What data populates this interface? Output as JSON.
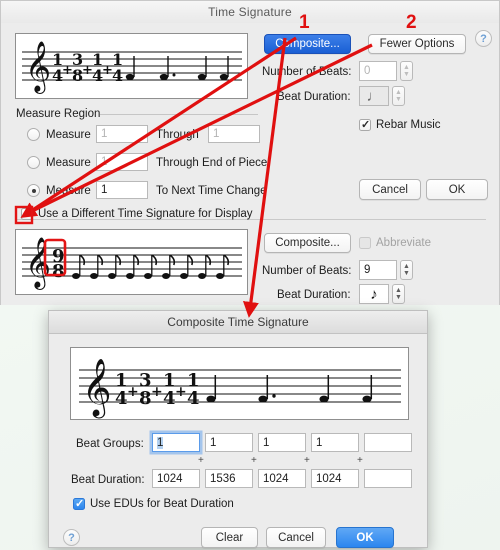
{
  "main_window": {
    "title": "Time Signature",
    "help_icon": "?",
    "buttons": {
      "composite_top": "Composite...",
      "fewer_options": "Fewer Options",
      "cancel": "Cancel",
      "ok": "OK"
    },
    "labels": {
      "number_of_beats": "Number of Beats:",
      "beat_duration": "Beat Duration:",
      "rebar_music": "Rebar Music",
      "measure_region": "Measure Region"
    },
    "fields": {
      "number_of_beats_value": "0",
      "beat_duration_glyph": "♩"
    },
    "measure_region": {
      "rows": [
        {
          "label": "Measure",
          "value": "1",
          "through_label": "Through",
          "through_value": "1",
          "selected": false
        },
        {
          "label": "Measure",
          "value": "1",
          "through_label": "Through End of Piece",
          "through_value": "",
          "selected": false
        },
        {
          "label": "Measure",
          "value": "1",
          "through_label": "To Next Time Change",
          "through_value": "",
          "selected": true
        }
      ]
    },
    "display_section": {
      "checkbox_label": "Use a Different Time Signature for Display",
      "checkbox_checked": true,
      "composite_button": "Composite...",
      "abbreviate_label": "Abbreviate",
      "abbreviate_checked": false,
      "abbreviate_disabled": true,
      "number_of_beats_label": "Number of Beats:",
      "number_of_beats_value": "9",
      "beat_duration_label": "Beat Duration:",
      "beat_duration_glyph": "♪"
    },
    "staff_top": {
      "time_signature": "1/4 + 3/8 + 1/4 + 1/4",
      "numerators": [
        "1",
        "3",
        "1",
        "1"
      ],
      "denominators": [
        "4",
        "8",
        "4",
        "4"
      ],
      "plus": "+",
      "note_count": 4
    },
    "staff_display": {
      "time_signature": "9/8",
      "numerator": "9",
      "denominator": "8",
      "note_count": 9,
      "highlighted": true
    }
  },
  "composite_dialog": {
    "title": "Composite Time Signature",
    "help_icon": "?",
    "staff": {
      "time_signature": "1/4 + 3/8 + 1/4 + 1/4",
      "numerators": [
        "1",
        "3",
        "1",
        "1"
      ],
      "denominators": [
        "4",
        "8",
        "4",
        "4"
      ],
      "plus": "+",
      "note_count": 4
    },
    "beat_groups_label": "Beat Groups:",
    "beat_groups": [
      "1",
      "1",
      "1",
      "1",
      ""
    ],
    "beat_groups_focused_index": 0,
    "plus_separator": "+",
    "beat_duration_label": "Beat Duration:",
    "beat_durations": [
      "1024",
      "1536",
      "1024",
      "1024",
      ""
    ],
    "use_edus_label": "Use EDUs for Beat Duration",
    "use_edus_checked": true,
    "buttons": {
      "clear": "Clear",
      "cancel": "Cancel",
      "ok": "OK"
    }
  },
  "annotations": {
    "marker_1": "1",
    "marker_2": "2",
    "arrow_color": "#e01010"
  },
  "colors": {
    "accent_blue": "#1a5fd4",
    "ok_blue": "#2b86ef",
    "annotation_red": "#e01010",
    "window_bg": "#ececec",
    "desktop_bg": "#eef5ee"
  }
}
